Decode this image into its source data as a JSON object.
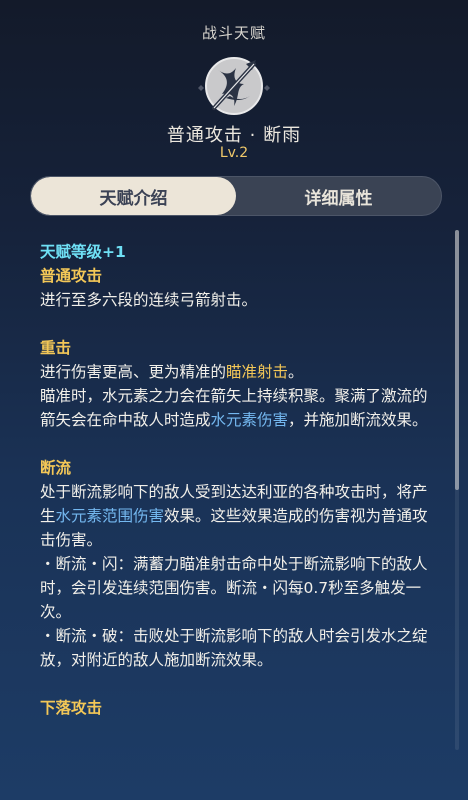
{
  "header": {
    "title": "战斗天赋",
    "emblem_icon": "crossed-arrows-icon"
  },
  "skill": {
    "name": "普通攻击 · 断雨",
    "level": "Lv.2"
  },
  "tabs": [
    {
      "label": "天赋介绍",
      "active": true
    },
    {
      "label": "详细属性",
      "active": false
    }
  ],
  "content": {
    "level_bonus": "天赋等级+1",
    "normal_attack": {
      "title": "普通攻击",
      "text": "进行至多六段的连续弓箭射击。"
    },
    "charged_attack": {
      "title": "重击",
      "line1_a": "进行伤害更高、更为精准的",
      "line1_hl": "瞄准射击",
      "line1_b": "。",
      "line2_a": "瞄准时，水元素之力会在箭矢上持续积聚。聚满了激流的箭矢会在命中敌人时造成",
      "line2_hl": "水元素伤害",
      "line2_b": "，并施加断流效果。"
    },
    "riptide": {
      "title": "断流",
      "p1_a": "处于断流影响下的敌人受到达达利亚的各种攻击时，将产生",
      "p1_hl": "水元素范围伤害",
      "p1_b": "效果。这些效果造成的伤害视为普通攻击伤害。",
      "p2": "・断流・闪：满蓄力瞄准射击命中处于断流影响下的敌人时，会引发连续范围伤害。断流・闪每0.7秒至多触发一次。",
      "p3": "・断流・破：击败处于断流影响下的敌人时会引发水之绽放，对附近的敌人施加断流效果。"
    },
    "plunge": {
      "title": "下落攻击"
    }
  },
  "colors": {
    "gold": "#f3c757",
    "cyan": "#6fe0f5",
    "hydro_blue": "#74b8f0",
    "tab_active_bg": "#ece5d8"
  }
}
